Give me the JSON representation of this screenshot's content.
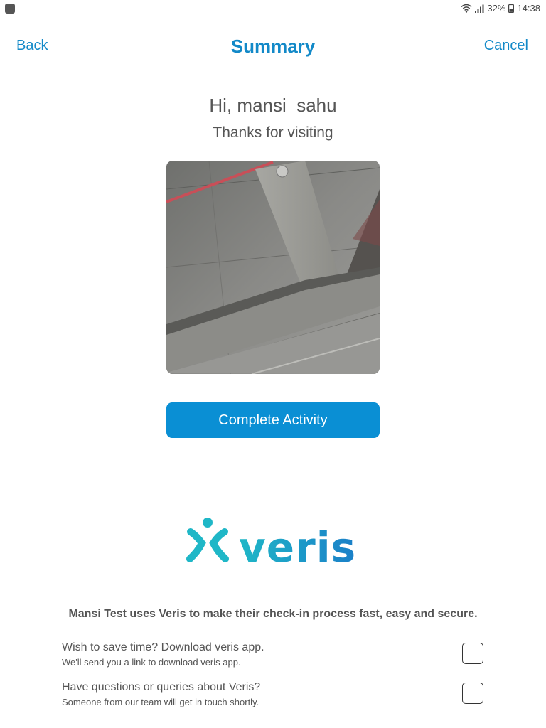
{
  "status_bar": {
    "battery": "32%",
    "time": "14:38"
  },
  "header": {
    "back_label": "Back",
    "title": "Summary",
    "cancel_label": "Cancel"
  },
  "greeting": "Hi, mansi  sahu",
  "subtitle": "Thanks for visiting",
  "visitor_photo": "captured-photo",
  "complete_button_label": "Complete Activity",
  "brand": {
    "name": "veris",
    "accent_teal": "#1fb7c7",
    "accent_blue": "#1a7fc8"
  },
  "disclaimer": "Mansi Test uses Veris to make their check-in process fast, easy and secure.",
  "options": [
    {
      "title": "Wish to save time? Download veris app.",
      "subtitle": "We'll send you a link to download veris app.",
      "checked": false
    },
    {
      "title": "Have questions or queries about Veris?",
      "subtitle": "Someone from our team will get in touch shortly.",
      "checked": false
    }
  ]
}
